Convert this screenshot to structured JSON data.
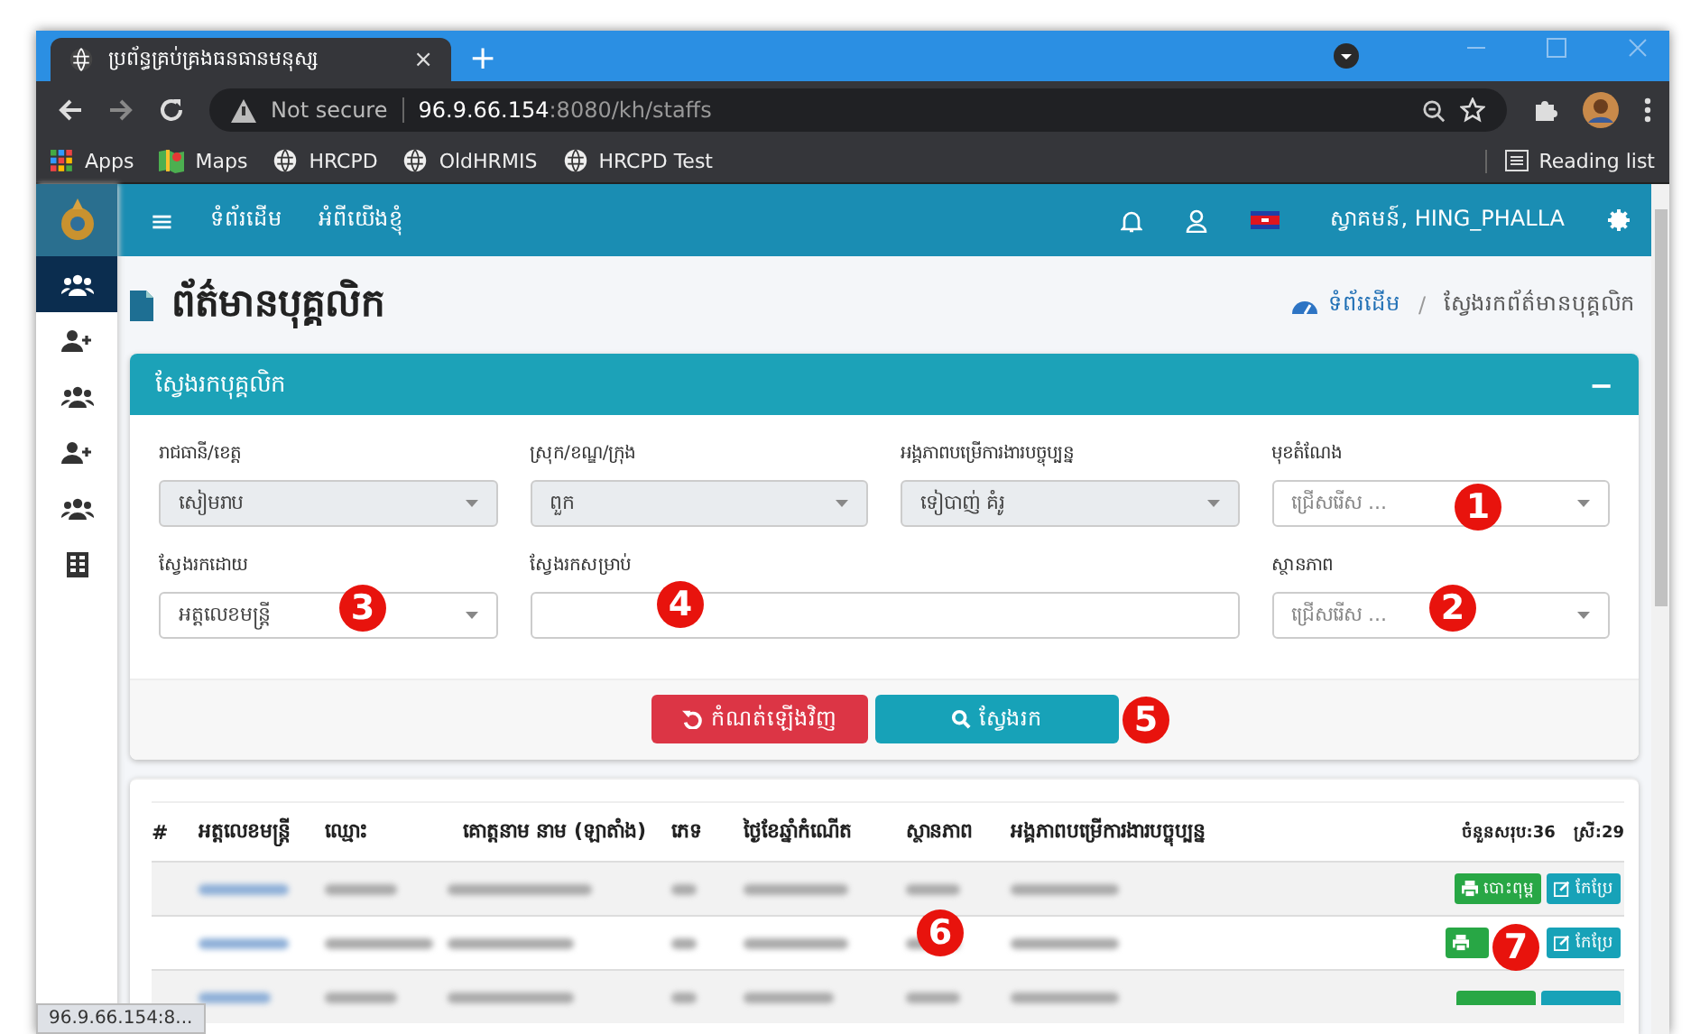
{
  "browser": {
    "tab_title": "ប្រព័ន្ធគ្រប់គ្រងធនធានមនុស្ស",
    "tab_close": "×",
    "new_tab": "+",
    "security": "Not secure",
    "url_host": "96.9.66.154",
    "url_rest": ":8080/kh/staffs",
    "bookmarks": [
      {
        "label": "Apps",
        "kind": "apps"
      },
      {
        "label": "Maps",
        "kind": "maps"
      },
      {
        "label": "HRCPD",
        "kind": "globe"
      },
      {
        "label": "OldHRMIS",
        "kind": "globe"
      },
      {
        "label": "HRCPD Test",
        "kind": "globe"
      }
    ],
    "reading_list": "Reading list",
    "status_url": "96.9.66.154:8..."
  },
  "navbar": {
    "menu_icon": "≡",
    "links": [
      "ទំព័រដើម",
      "អំពីយើងខ្ញុំ"
    ],
    "user": "ស្វាគមន៍, HING_PHALLA"
  },
  "sidebar": {
    "items": [
      {
        "kind": "users",
        "selected": true
      },
      {
        "kind": "user-plus",
        "selected": false
      },
      {
        "kind": "users",
        "selected": false
      },
      {
        "kind": "user-plus",
        "selected": false
      },
      {
        "kind": "users",
        "selected": false
      },
      {
        "kind": "building",
        "selected": false
      }
    ]
  },
  "page": {
    "title": "ព័ត៌មានបុគ្គលិក",
    "breadcrumb": [
      "ទំព័រដើម",
      "ស្វែងរកព័ត៌មានបុគ្គលិក"
    ],
    "breadcrumb_separator": "/"
  },
  "search_panel": {
    "title": "ស្វែងរកបុគ្គលិក",
    "collapse": "−",
    "fields": [
      {
        "label": "រាជធានី/ខេត្ត",
        "kind": "select",
        "value": "សៀមរាប",
        "disabled": true
      },
      {
        "label": "ស្រុក/ខណ្ឌ/ក្រុង",
        "kind": "select",
        "value": "ពួក",
        "disabled": true
      },
      {
        "label": "អង្គភាពបម្រើការងារបច្ចុប្បន្ន",
        "kind": "select",
        "value": "ទៀបាញ់ គំរូ",
        "disabled": true
      },
      {
        "label": "មុខតំណែង",
        "kind": "select",
        "placeholder": "ជ្រើសរើស ...",
        "disabled": false
      },
      {
        "label": "ស្វែងរកដោយ",
        "kind": "select",
        "value": "អត្តលេខមន្ត្រី",
        "disabled": false
      },
      {
        "label": "ស្វែងរកសម្រាប់",
        "kind": "text",
        "disabled": false
      },
      {
        "label": "ស្ថានភាព",
        "kind": "select",
        "placeholder": "ជ្រើសរើស ...",
        "disabled": false
      }
    ],
    "reset_button": "កំណត់ឡើងវិញ",
    "search_button": "ស្វែងរក"
  },
  "table": {
    "columns": [
      "#",
      "អត្តលេខមន្ត្រី",
      "ឈ្មោះ",
      "គោត្តនាម នាម (ឡាតាំង)",
      "ភេទ",
      "ថ្ងៃខែឆ្នាំកំណើត",
      "ស្ថានភាព",
      "អង្គភាពបម្រើការងារបច្ចុប្បន្ន",
      "ចំនួនសរុប:36",
      "ស្រី:29"
    ],
    "rows": [
      {
        "print": "បោះពុម្ព",
        "edit": "កែប្រែ"
      },
      {
        "edit": "កែប្រែ"
      },
      {}
    ]
  },
  "annotations": [
    "1",
    "3",
    "4",
    "2",
    "5",
    "6",
    "7"
  ]
}
